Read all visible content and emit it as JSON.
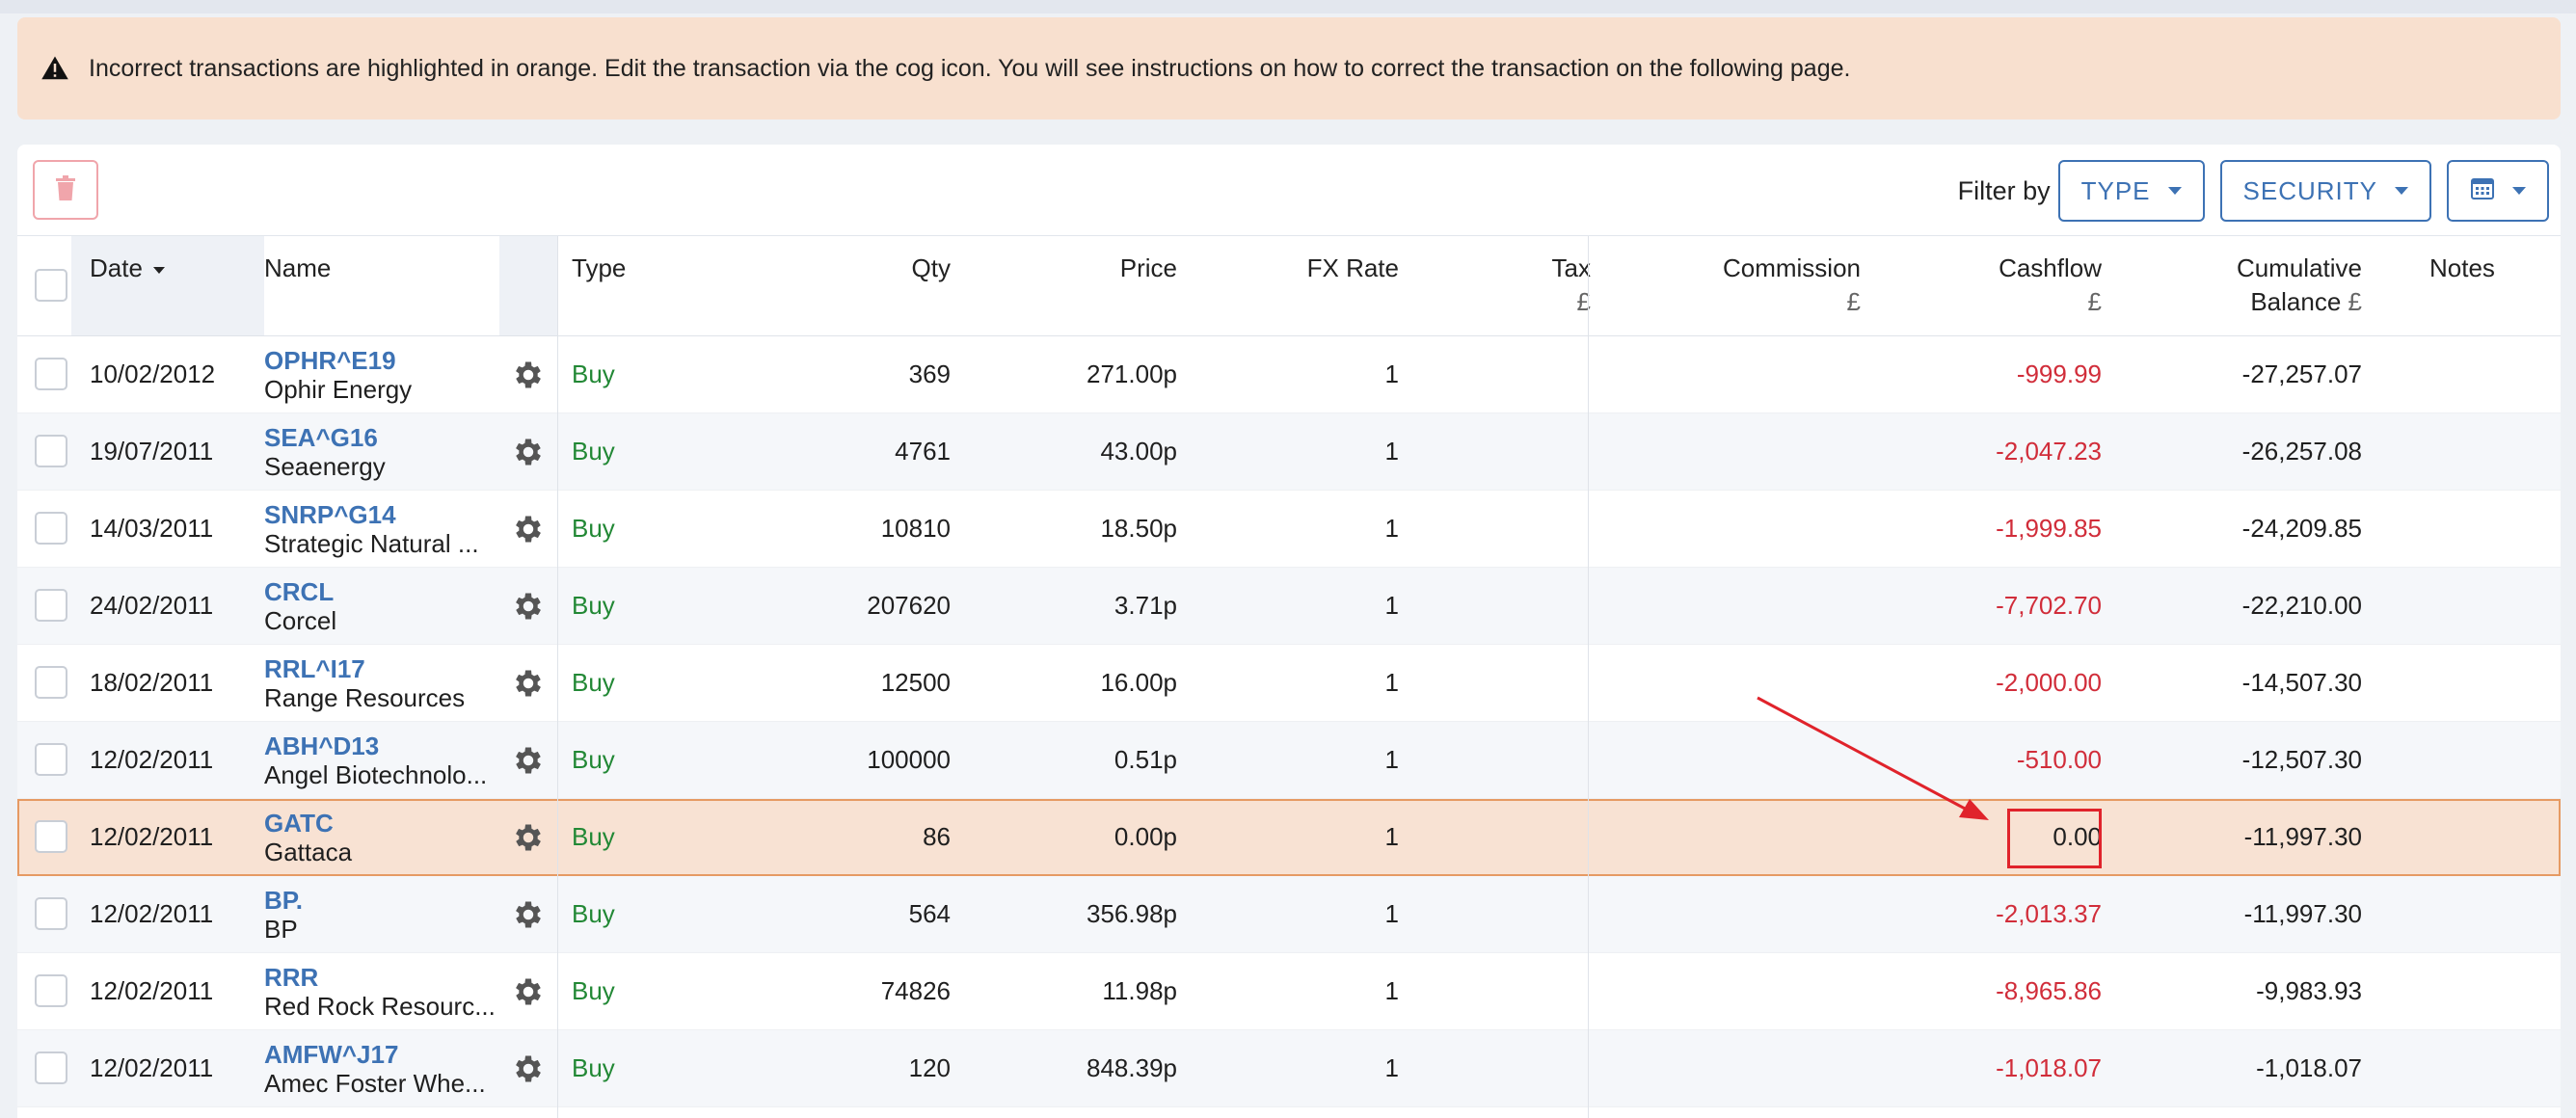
{
  "alert": {
    "icon": "warning-triangle-icon",
    "message": "Incorrect transactions are highlighted in orange. Edit the transaction via the cog icon. You will see instructions on how to correct the transaction on the following page."
  },
  "toolbar": {
    "delete_icon": "trash-icon",
    "filter_label": "Filter by",
    "type_label": "TYPE",
    "security_label": "SECURITY",
    "calendar_icon": "calendar-icon"
  },
  "columns": {
    "date": "Date",
    "name": "Name",
    "type": "Type",
    "qty": "Qty",
    "price": "Price",
    "fx": "FX Rate",
    "tax": "Tax",
    "tax_unit": "£",
    "commission": "Commission",
    "commission_unit": "£",
    "cashflow": "Cashflow",
    "cashflow_unit": "£",
    "cumulative_1": "Cumulative",
    "cumulative_2": "Balance",
    "cumulative_unit": "£",
    "notes": "Notes"
  },
  "rows": [
    {
      "date": "10/02/2012",
      "ticker": "OPHR^E19",
      "name": "Ophir Energy",
      "type": "Buy",
      "qty": "369",
      "price": "271.00p",
      "fx": "1",
      "tax": "",
      "commission": "",
      "cashflow": "-999.99",
      "cumulative": "-27,257.07",
      "notes": ""
    },
    {
      "date": "19/07/2011",
      "ticker": "SEA^G16",
      "name": "Seaenergy",
      "type": "Buy",
      "qty": "4761",
      "price": "43.00p",
      "fx": "1",
      "tax": "",
      "commission": "",
      "cashflow": "-2,047.23",
      "cumulative": "-26,257.08",
      "notes": ""
    },
    {
      "date": "14/03/2011",
      "ticker": "SNRP^G14",
      "name": "Strategic Natural ...",
      "type": "Buy",
      "qty": "10810",
      "price": "18.50p",
      "fx": "1",
      "tax": "",
      "commission": "",
      "cashflow": "-1,999.85",
      "cumulative": "-24,209.85",
      "notes": ""
    },
    {
      "date": "24/02/2011",
      "ticker": "CRCL",
      "name": "Corcel",
      "type": "Buy",
      "qty": "207620",
      "price": "3.71p",
      "fx": "1",
      "tax": "",
      "commission": "",
      "cashflow": "-7,702.70",
      "cumulative": "-22,210.00",
      "notes": ""
    },
    {
      "date": "18/02/2011",
      "ticker": "RRL^I17",
      "name": "Range Resources",
      "type": "Buy",
      "qty": "12500",
      "price": "16.00p",
      "fx": "1",
      "tax": "",
      "commission": "",
      "cashflow": "-2,000.00",
      "cumulative": "-14,507.30",
      "notes": ""
    },
    {
      "date": "12/02/2011",
      "ticker": "ABH^D13",
      "name": "Angel Biotechnolo...",
      "type": "Buy",
      "qty": "100000",
      "price": "0.51p",
      "fx": "1",
      "tax": "",
      "commission": "",
      "cashflow": "-510.00",
      "cumulative": "-12,507.30",
      "notes": ""
    },
    {
      "date": "12/02/2011",
      "ticker": "GATC",
      "name": "Gattaca",
      "type": "Buy",
      "qty": "86",
      "price": "0.00p",
      "fx": "1",
      "tax": "",
      "commission": "",
      "cashflow": "0.00",
      "cumulative": "-11,997.30",
      "notes": "",
      "incorrect": true
    },
    {
      "date": "12/02/2011",
      "ticker": "BP.",
      "name": "BP",
      "type": "Buy",
      "qty": "564",
      "price": "356.98p",
      "fx": "1",
      "tax": "",
      "commission": "",
      "cashflow": "-2,013.37",
      "cumulative": "-11,997.30",
      "notes": ""
    },
    {
      "date": "12/02/2011",
      "ticker": "RRR",
      "name": "Red Rock Resourc...",
      "type": "Buy",
      "qty": "74826",
      "price": "11.98p",
      "fx": "1",
      "tax": "",
      "commission": "",
      "cashflow": "-8,965.86",
      "cumulative": "-9,983.93",
      "notes": ""
    },
    {
      "date": "12/02/2011",
      "ticker": "AMFW^J17",
      "name": "Amec Foster Whe...",
      "type": "Buy",
      "qty": "120",
      "price": "848.39p",
      "fx": "1",
      "tax": "",
      "commission": "",
      "cashflow": "-1,018.07",
      "cumulative": "-1,018.07",
      "notes": ""
    }
  ],
  "colors": {
    "accent": "#3d72b4",
    "buy": "#228835",
    "negative": "#d12d3a",
    "error_row": "#f8e2d3",
    "annotation": "#e0232b"
  },
  "row_icon": "gear-icon"
}
